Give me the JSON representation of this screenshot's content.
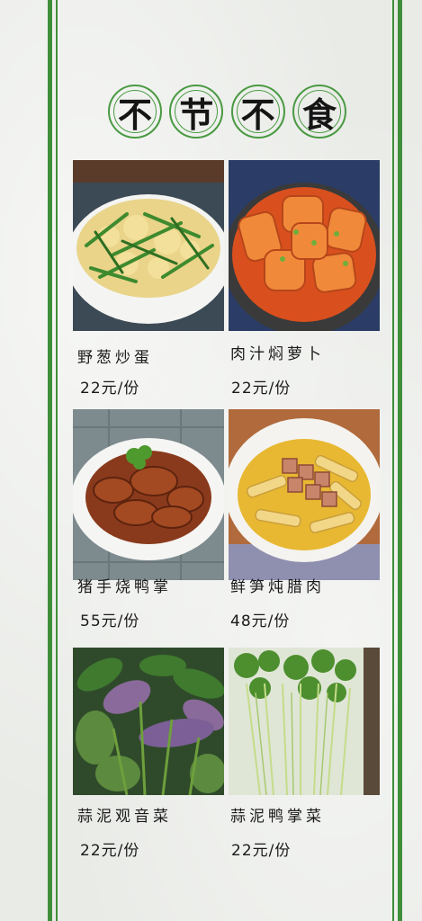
{
  "title": {
    "chars": [
      "不",
      "节",
      "不",
      "食"
    ]
  },
  "dishes": [
    {
      "name": "野葱炒蛋",
      "price": "22元/份"
    },
    {
      "name": "肉汁焖萝卜",
      "price": "22元/份"
    },
    {
      "name": "猪手烧鸭掌",
      "price": "55元/份"
    },
    {
      "name": "鲜笋炖腊肉",
      "price": "48元/份"
    },
    {
      "name": "蒜泥观音菜",
      "price": "22元/份"
    },
    {
      "name": "蒜泥鸭掌菜",
      "price": "22元/份"
    }
  ],
  "colors": {
    "accent": "#3f8f3a",
    "background": "#e9ebe7",
    "text": "#1a1a1a"
  }
}
